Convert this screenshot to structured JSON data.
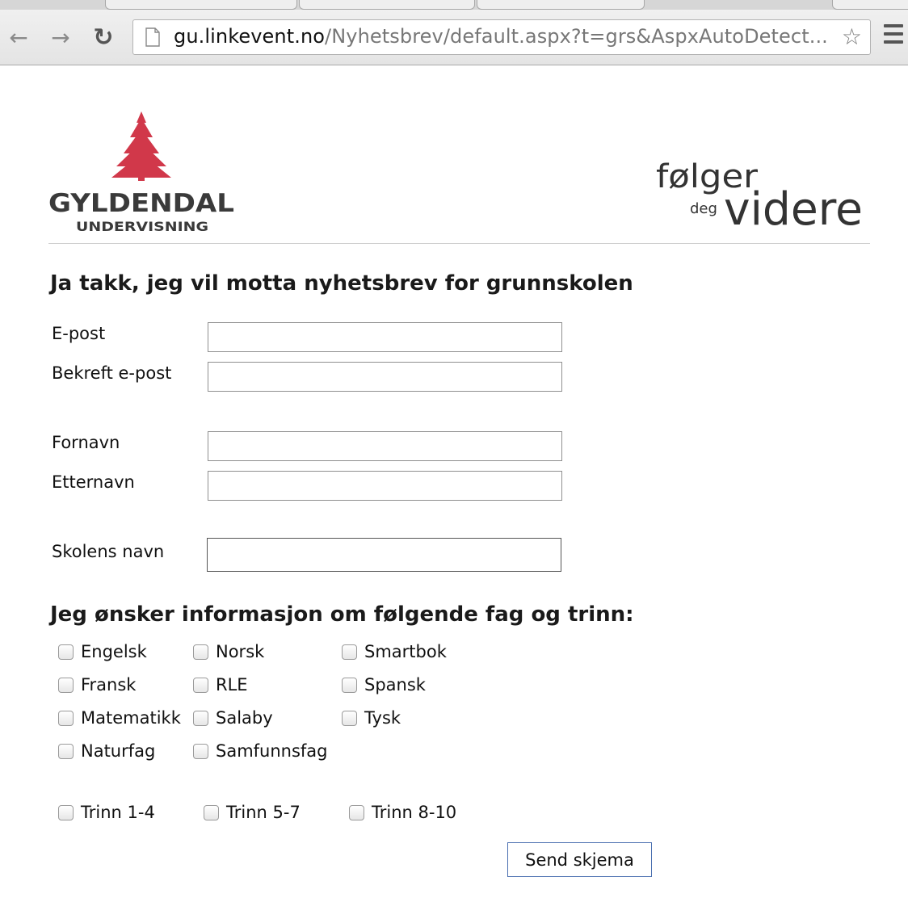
{
  "browser": {
    "url_host": "gu.linkevent.no",
    "url_path": "/Nyhetsbrev/default.aspx?t=grs&AspxAutoDetect...",
    "icons": [
      "back-arrow-icon",
      "forward-arrow-icon",
      "reload-icon",
      "page-icon",
      "bookmark-star-icon",
      "menu-icon"
    ]
  },
  "header": {
    "logo_left_name": "GYLDENDAL",
    "logo_left_sub": "UNDERVISNING",
    "logo_right_line1": "følger",
    "logo_right_small": "deg",
    "logo_right_big": "videre",
    "brand_color": "#d1384a"
  },
  "form": {
    "title": "Ja takk, jeg vil motta nyhetsbrev for grunnskolen",
    "email_label": "E-post",
    "confirm_email_label": "Bekreft e-post",
    "first_name_label": "Fornavn",
    "last_name_label": "Etternavn",
    "school_label": "Skolens navn",
    "email_value": "",
    "confirm_email_value": "",
    "first_name_value": "",
    "last_name_value": "",
    "school_value": "",
    "subjects_heading": "Jeg ønsker informasjon om følgende fag og trinn:",
    "subjects": [
      {
        "label": "Engelsk",
        "checked": false
      },
      {
        "label": "Norsk",
        "checked": false
      },
      {
        "label": "Smartbok",
        "checked": false
      },
      {
        "label": "Fransk",
        "checked": false
      },
      {
        "label": "RLE",
        "checked": false
      },
      {
        "label": "Spansk",
        "checked": false
      },
      {
        "label": "Matematikk",
        "checked": false
      },
      {
        "label": "Salaby",
        "checked": false
      },
      {
        "label": "Tysk",
        "checked": false
      },
      {
        "label": "Naturfag",
        "checked": false
      },
      {
        "label": "Samfunnsfag",
        "checked": false
      }
    ],
    "grades": [
      {
        "label": "Trinn 1-4",
        "checked": false
      },
      {
        "label": "Trinn 5-7",
        "checked": false
      },
      {
        "label": "Trinn 8-10",
        "checked": false
      }
    ],
    "submit_label": "Send skjema"
  }
}
